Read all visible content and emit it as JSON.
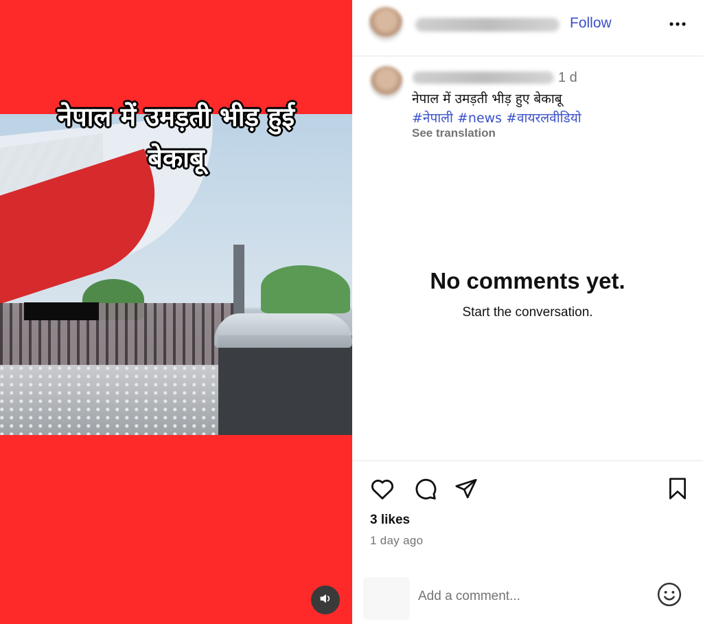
{
  "media": {
    "overlay_title_line1": "नेपाल में उमड़ती भीड़ हुई",
    "overlay_title_line2": "बेकाबू",
    "background_color": "#fe2a2a"
  },
  "header": {
    "follow_label": "Follow",
    "more_icon": "more-horizontal-icon"
  },
  "caption": {
    "time_ago": "1 d",
    "text": "नेपाल में उमड़ती भीड़ हुए बेकाबू",
    "hashtags": [
      "#नेपाली",
      "#news",
      "#वायरलवीडियो"
    ],
    "see_translation": "See translation"
  },
  "comments": {
    "empty_title": "No comments yet.",
    "empty_subtitle": "Start the conversation."
  },
  "actions": {
    "likes": "3 likes",
    "date": "1 day ago"
  },
  "comment_box": {
    "placeholder": "Add a comment..."
  },
  "colors": {
    "link_blue": "#3b50c9",
    "muted_gray": "#737373"
  }
}
